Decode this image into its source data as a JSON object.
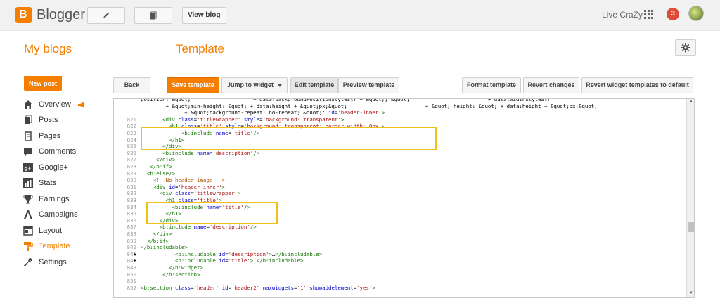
{
  "topbar": {
    "brand": "Blogger",
    "view_blog_label": "View blog",
    "username": "Live CraZy",
    "notification_count": "3"
  },
  "header": {
    "my_blogs": "My blogs",
    "page_title": "Template"
  },
  "sidebar": {
    "new_post_label": "New post",
    "items": [
      {
        "label": "Overview",
        "icon": "home-icon"
      },
      {
        "label": "Posts",
        "icon": "posts-icon"
      },
      {
        "label": "Pages",
        "icon": "pages-icon"
      },
      {
        "label": "Comments",
        "icon": "comments-icon"
      },
      {
        "label": "Google+",
        "icon": "googleplus-icon"
      },
      {
        "label": "Stats",
        "icon": "stats-icon"
      },
      {
        "label": "Earnings",
        "icon": "trophy-icon"
      },
      {
        "label": "Campaigns",
        "icon": "campaigns-icon"
      },
      {
        "label": "Layout",
        "icon": "layout-icon"
      },
      {
        "label": "Template",
        "icon": "paint-roller-icon",
        "active": true
      },
      {
        "label": "Settings",
        "icon": "wrench-icon"
      }
    ]
  },
  "toolbar": {
    "back": "Back",
    "save_template": "Save template",
    "jump_to_widget": "Jump to widget",
    "edit_template": "Edit template",
    "preview_template": "Preview template",
    "format_template": "Format template",
    "revert_changes": "Revert changes",
    "revert_widget_templates": "Revert widget templates to default"
  },
  "editor": {
    "lines": [
      {
        "n": "",
        "code": "position: &quot;                    + data:backgroundPositionStyleStr + &quot;; &quot;                         + data:widthStyleStr"
      },
      {
        "n": "",
        "code": "        + &quot;min-height: &quot; + data:height + &quot;px;&quot;                         + &quot;_height: &quot; + data:height + &quot;px;&quot;"
      },
      {
        "n": "",
        "code": "              + &quot;background-repeat: no-repeat; &quot;' id='header-inner'>"
      },
      {
        "n": "821",
        "code": "       <div class='titlewrapper' style='background: transparent'>"
      },
      {
        "n": "822",
        "code": "         <h1 class='title' style='background: transparent; border-width: 0px'>"
      },
      {
        "n": "823",
        "code": "             <b:include name='title'/>"
      },
      {
        "n": "824",
        "code": "         </h1>"
      },
      {
        "n": "825",
        "code": "       </div>"
      },
      {
        "n": "826",
        "code": "       <b:include name='description'/>"
      },
      {
        "n": "827",
        "code": "     </div>"
      },
      {
        "n": "828",
        "code": "   </b:if>"
      },
      {
        "n": "829",
        "code": "  <b:else/>"
      },
      {
        "n": "830",
        "code": "    <!--No header image -->"
      },
      {
        "n": "831",
        "code": "    <div id='header-inner'>"
      },
      {
        "n": "832",
        "code": "      <div class='titlewrapper'>"
      },
      {
        "n": "833",
        "code": "        <h1 class='title'>"
      },
      {
        "n": "834",
        "code": "          <b:include name='title'/>"
      },
      {
        "n": "835",
        "code": "        </h1>"
      },
      {
        "n": "836",
        "code": "      </div>"
      },
      {
        "n": "837",
        "code": "      <b:include name='description'/>"
      },
      {
        "n": "838",
        "code": "    </div>"
      },
      {
        "n": "839",
        "code": "  </b:if>"
      },
      {
        "n": "840",
        "code": "</b:includable>"
      },
      {
        "n": "841",
        "code": "           <b:includable id='description'>…</b:includable>",
        "arrow": true
      },
      {
        "n": "846",
        "code": "           <b:includable id='title'>…</b:includable>",
        "arrow": true
      },
      {
        "n": "849",
        "code": "         </b:widget>"
      },
      {
        "n": "850",
        "code": "       </b:section>"
      },
      {
        "n": "851",
        "code": ""
      },
      {
        "n": "852",
        "code": "<b:section class='header' id='header2' maxwidgets='1' showaddelement='yes'>"
      }
    ]
  },
  "colors": {
    "accent": "#f57d00",
    "highlight_box": "#f2c012",
    "notification": "#dd4b39"
  }
}
